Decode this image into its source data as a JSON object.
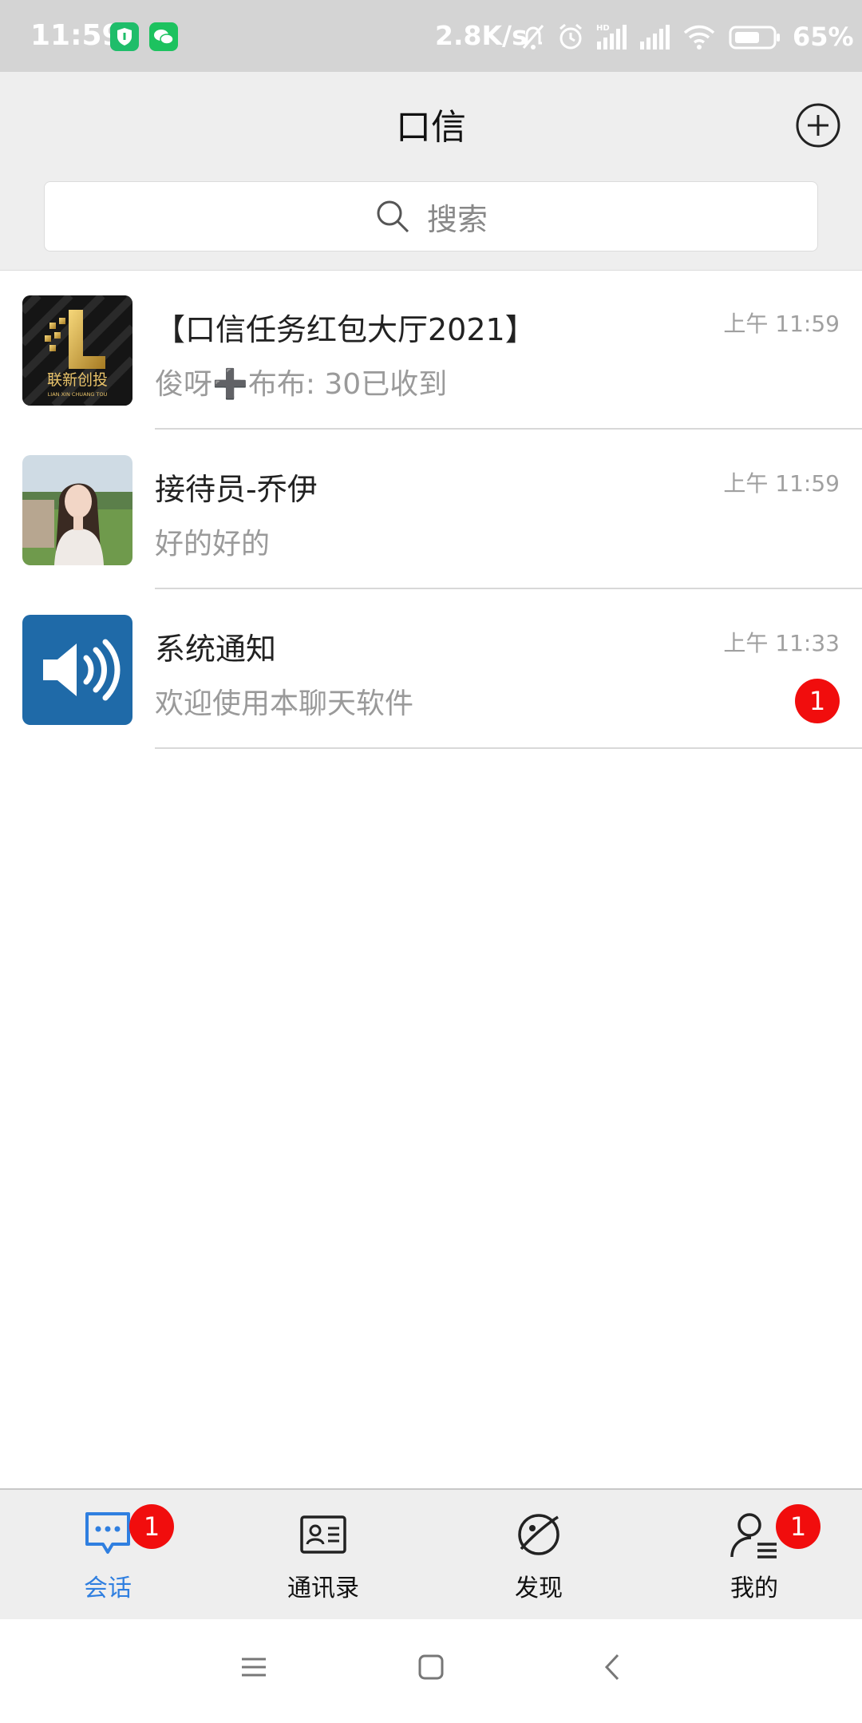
{
  "status_bar": {
    "time": "11:59",
    "net_speed": "2.8K/s",
    "battery": "65%",
    "icons": [
      "shield-app-icon",
      "wechat-icon",
      "mute-bell-icon",
      "alarm-icon",
      "hd-signal-icon",
      "signal-icon",
      "wifi-icon",
      "battery-icon"
    ]
  },
  "header": {
    "title": "口信",
    "add_icon": "plus-circle-icon",
    "search_placeholder": "搜索"
  },
  "conversations": [
    {
      "name": "【口信任务红包大厅2021】",
      "preview": "俊呀➕布布: 30已收到",
      "time": "上午 11:59",
      "avatar_text": "联新创投",
      "avatar_subtext": "LIAN XIN CHUANG TOU",
      "unread": ""
    },
    {
      "name": "接待员-乔伊",
      "preview": "好的好的",
      "time": "上午 11:59",
      "unread": ""
    },
    {
      "name": "系统通知",
      "preview": "欢迎使用本聊天软件",
      "time": "上午 11:33",
      "unread": "1"
    }
  ],
  "tabs": [
    {
      "label": "会话",
      "icon": "chat-bubble-icon",
      "badge": "1",
      "active": true
    },
    {
      "label": "通讯录",
      "icon": "contact-card-icon",
      "badge": "",
      "active": false
    },
    {
      "label": "发现",
      "icon": "planet-icon",
      "badge": "",
      "active": false
    },
    {
      "label": "我的",
      "icon": "profile-icon",
      "badge": "1",
      "active": false
    }
  ],
  "colors": {
    "accent": "#2f7fe0",
    "badge": "#f10d0d",
    "header_bg": "#eeeeee",
    "notice_avatar": "#1f6aa8"
  }
}
